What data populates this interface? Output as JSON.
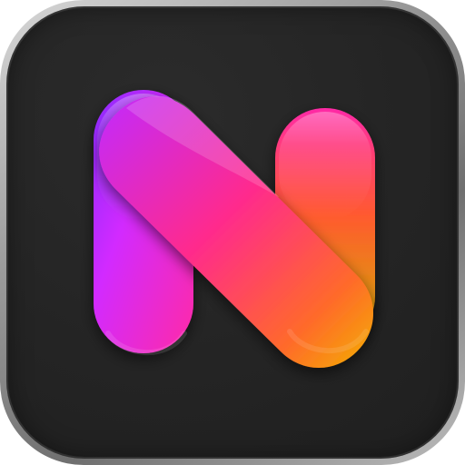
{
  "app_icon": {
    "icon_name": "n-letter-logo-icon",
    "colors": {
      "frame": "#a9a9a9",
      "background": "#242424",
      "gradient_purple": "#8a2bff",
      "gradient_magenta": "#ff2aa6",
      "gradient_orange": "#ff6a2a",
      "gradient_yellow": "#d3b300"
    }
  }
}
